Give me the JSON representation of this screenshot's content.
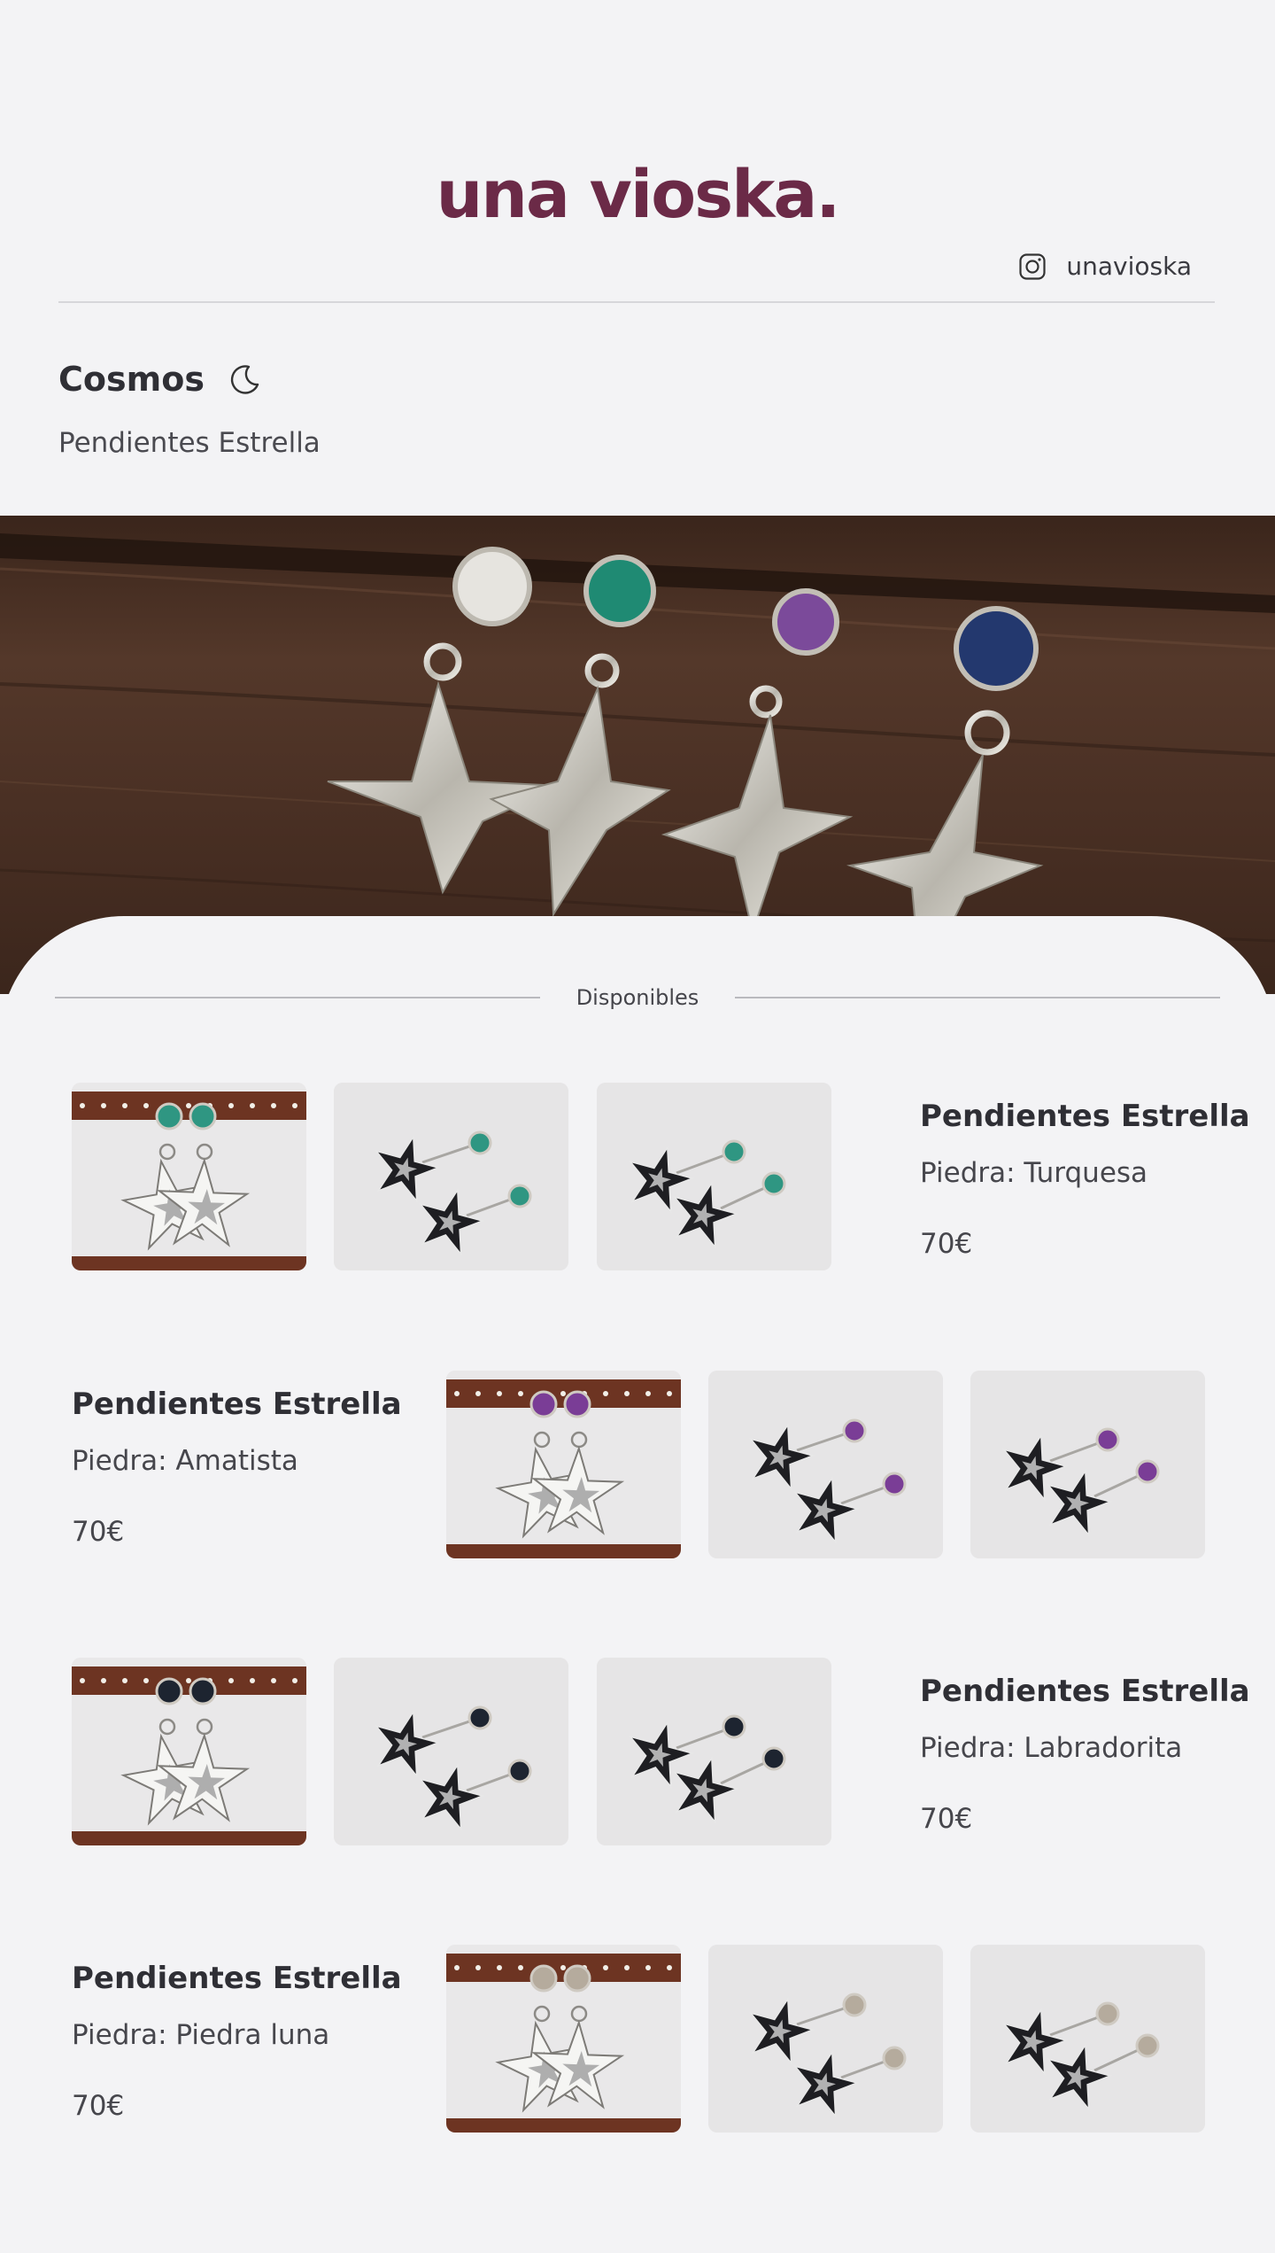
{
  "header": {
    "logo": "una vioska.",
    "instagram_handle": "unavioska",
    "instagram_icon": "instagram-icon"
  },
  "collection": {
    "title": "Cosmos",
    "title_icon": "moon-icon",
    "subtitle": "Pendientes Estrella"
  },
  "hero": {
    "image": "hero-earrings-photo",
    "stones": [
      "#e6e4df",
      "#1f8a73",
      "#7b4a9a",
      "#23386e"
    ]
  },
  "section": {
    "label": "Disponibles"
  },
  "products": [
    {
      "name": "Pendientes Estrella",
      "stone": "Piedra: Turquesa",
      "price": "70€",
      "stone_color": "#2f9682"
    },
    {
      "name": "Pendientes Estrella",
      "stone": "Piedra: Amatista",
      "price": "70€",
      "stone_color": "#7a3d96"
    },
    {
      "name": "Pendientes Estrella",
      "stone": "Piedra: Labradorita",
      "price": "70€",
      "stone_color": "#1d2430"
    },
    {
      "name": "Pendientes Estrella",
      "stone": "Piedra: Piedra luna",
      "price": "70€",
      "stone_color": "#b5ab9d"
    }
  ],
  "colors": {
    "brand": "#6b2a47",
    "background": "#f3f3f5",
    "text": "#2f2f35"
  }
}
